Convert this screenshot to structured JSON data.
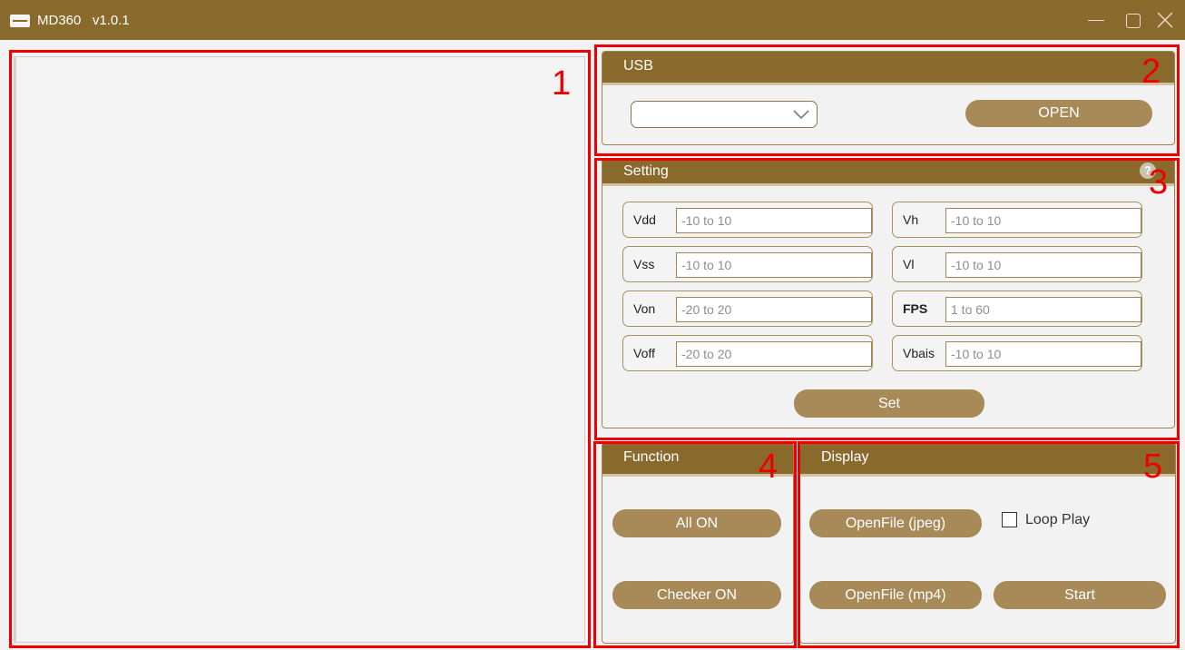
{
  "window": {
    "title": "MD360   v1.0.1",
    "icon": "app-logo-icon",
    "controls": [
      "minimize-icon",
      "maximize-icon",
      "close-icon"
    ]
  },
  "annotations": {
    "a1": "1",
    "a2": "2",
    "a3": "3",
    "a4": "4",
    "a5": "5",
    "color": "#ee0000"
  },
  "usb": {
    "title": "USB",
    "port_value": "",
    "open_label": "OPEN"
  },
  "setting": {
    "title": "Setting",
    "help_glyph": "?",
    "fields": [
      {
        "label": "Vdd",
        "placeholder": "-10 to 10"
      },
      {
        "label": "Vh",
        "placeholder": "-10 to 10"
      },
      {
        "label": "Vss",
        "placeholder": "-10 to 10"
      },
      {
        "label": "Vl",
        "placeholder": "-10 to 10"
      },
      {
        "label": "Von",
        "placeholder": "-20 to 20"
      },
      {
        "label": "FPS",
        "placeholder": "1 to 60"
      },
      {
        "label": "Voff",
        "placeholder": "-20 to 20"
      },
      {
        "label": "Vbais",
        "placeholder": "-10 to 10"
      }
    ],
    "set_label": "Set"
  },
  "function": {
    "title": "Function",
    "all_on_label": "All ON",
    "checker_on_label": "Checker ON"
  },
  "display": {
    "title": "Display",
    "open_jpeg_label": "OpenFile (jpeg)",
    "open_mp4_label": "OpenFile (mp4)",
    "loop_play_label": "Loop Play",
    "loop_play_checked": false,
    "start_label": "Start"
  },
  "colors": {
    "header": "#8a6a2c",
    "button": "#a78a57",
    "annotation": "#ee0000",
    "background": "#f2f2f2"
  }
}
